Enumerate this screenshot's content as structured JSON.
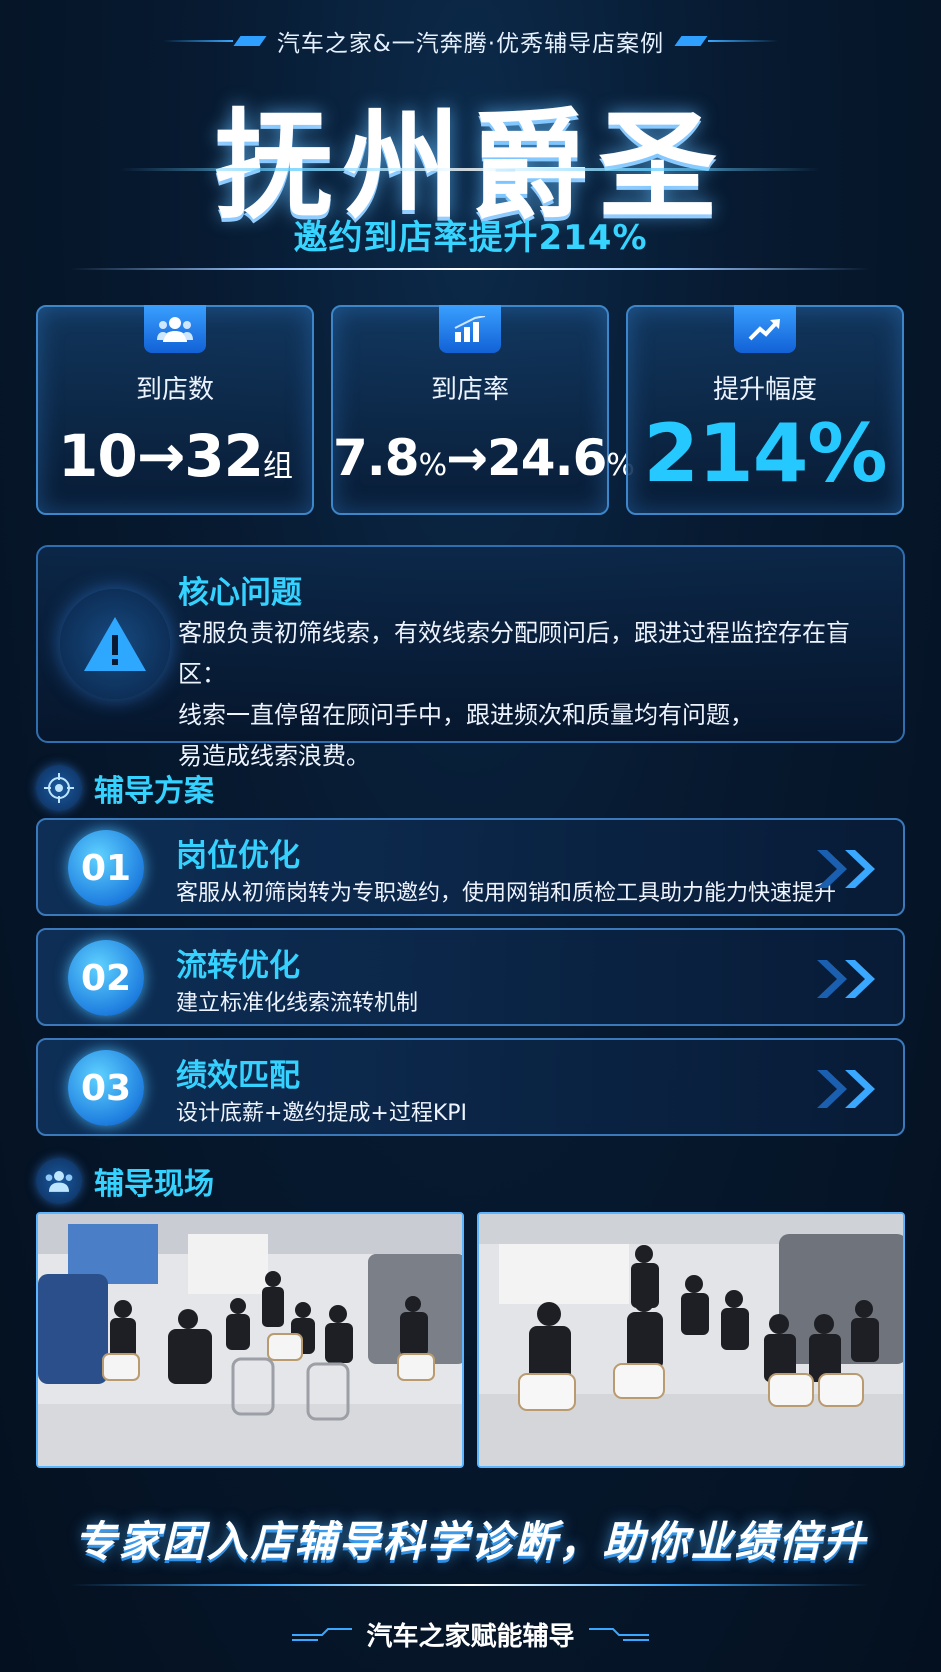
{
  "header": {
    "subtitle": "汽车之家&一汽奔腾·优秀辅导店案例",
    "title": "抚州爵圣",
    "headline": "邀约到店率提升214%"
  },
  "stats": [
    {
      "label": "到店数",
      "value_main": "10→32",
      "value_unit": "组",
      "icon": "group-icon"
    },
    {
      "label": "到店率",
      "value_a": "7.8",
      "unit_a": "%",
      "arrow": "→",
      "value_b": "24.6",
      "unit_b": "%",
      "icon": "bar-chart-icon"
    },
    {
      "label": "提升幅度",
      "value": "214%",
      "icon": "trend-up-icon"
    }
  ],
  "problem": {
    "title": "核心问题",
    "lines": [
      "客服负责初筛线索，有效线索分配顾问后，跟进过程监控存在盲区：",
      "线索一直停留在顾问手中，跟进频次和质量均有问题，",
      "易造成线索浪费。"
    ]
  },
  "plan": {
    "title": "辅导方案",
    "items": [
      {
        "num": "01",
        "title": "岗位优化",
        "desc": "客服从初筛岗转为专职邀约，使用网销和质检工具助力能力快速提升"
      },
      {
        "num": "02",
        "title": "流转优化",
        "desc": "建立标准化线索流转机制"
      },
      {
        "num": "03",
        "title": "绩效匹配",
        "desc": "设计底薪+邀约提成+过程KPI"
      }
    ]
  },
  "scene": {
    "title": "辅导现场"
  },
  "slogan": "专家团入店辅导科学诊断，助你业绩倍升",
  "footer": "汽车之家赋能辅导",
  "colors": {
    "accent_cyan": "#35d2ff",
    "background": "#071a31",
    "border_blue": "#3d86c9"
  }
}
